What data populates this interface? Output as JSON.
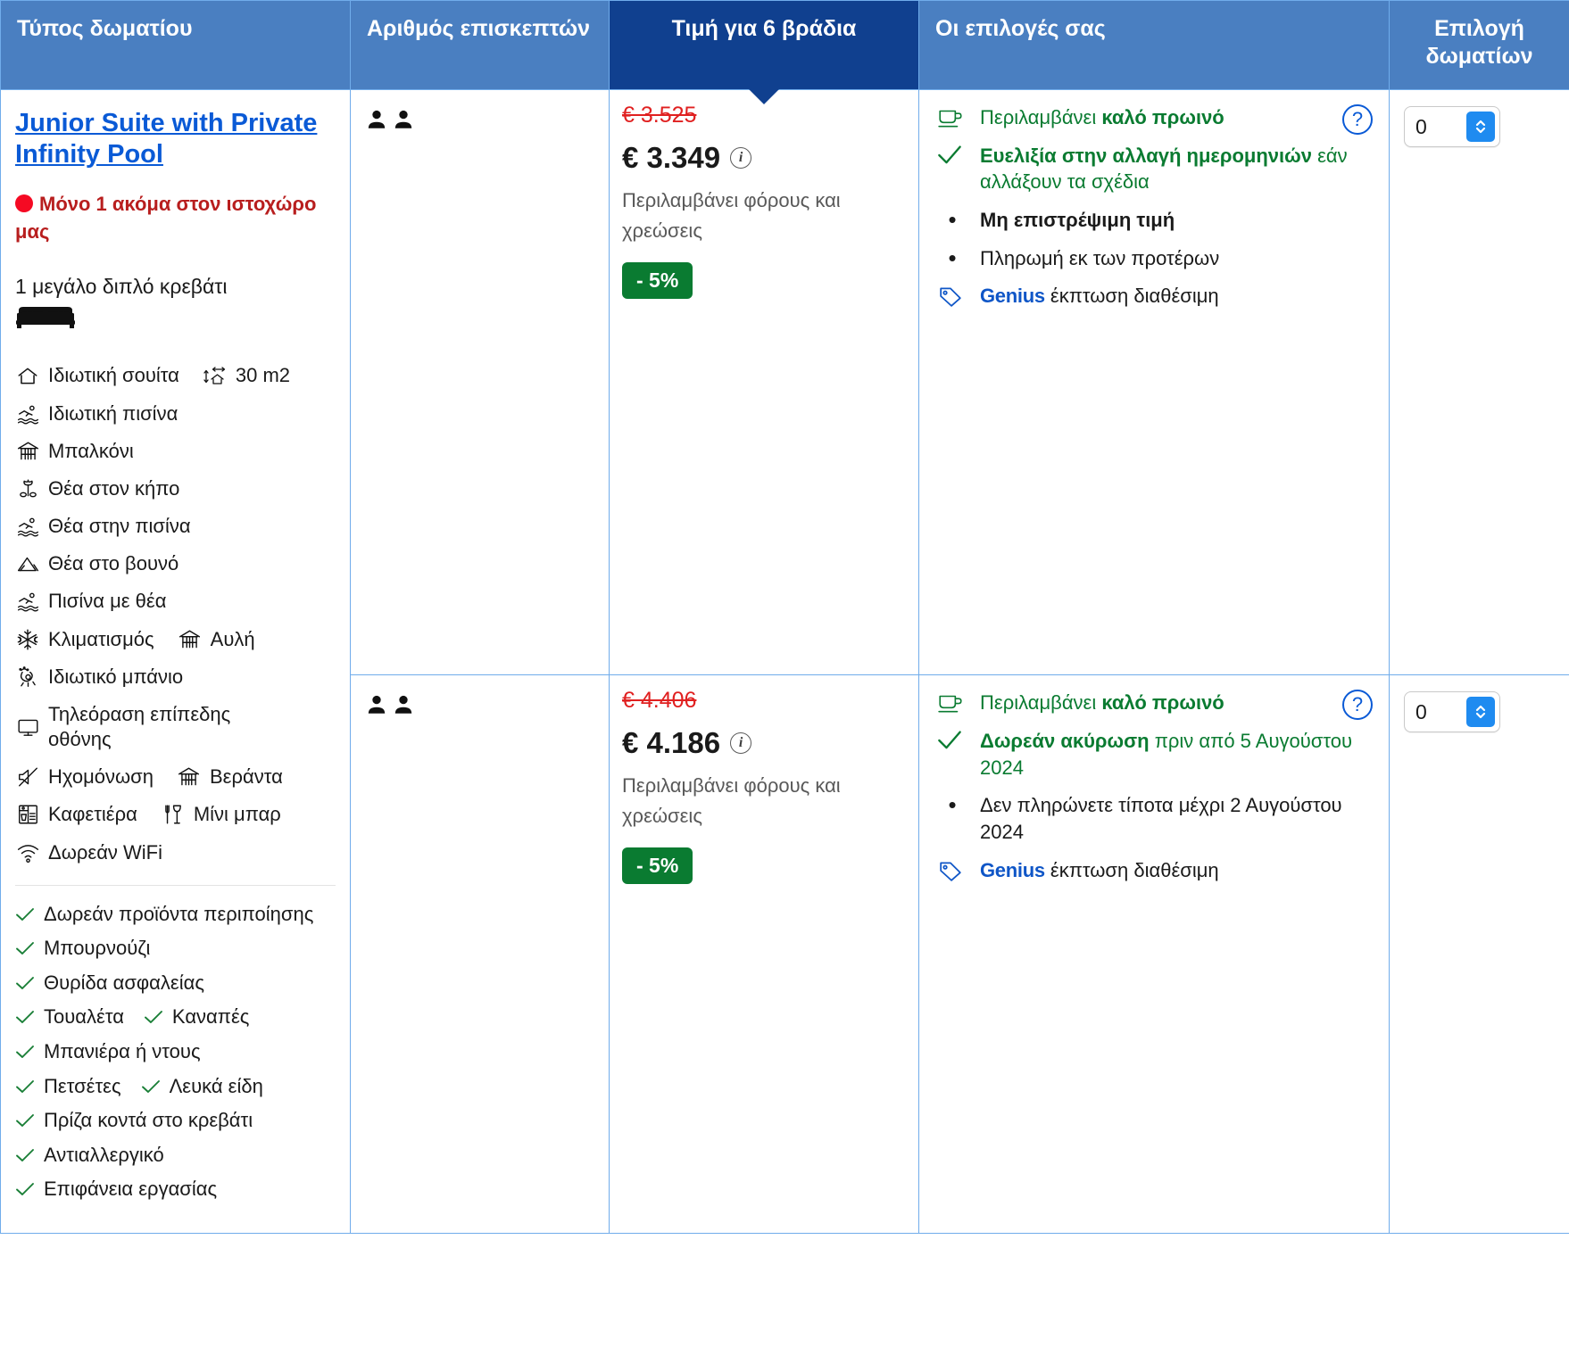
{
  "header": {
    "room_type": "Τύπος δωματίου",
    "guests": "Αριθμός επισκεπτών",
    "price": "Τιμή για 6 βράδια",
    "options": "Οι επιλογές σας",
    "select": "Επιλογή δωματίων"
  },
  "room": {
    "title": "Junior Suite with Private Infinity Pool",
    "scarcity": "Μόνο 1 ακόμα στον ιστοχώρο μας",
    "bed": "1 μεγάλο διπλό κρεβάτι",
    "facilities": [
      [
        {
          "icon": "house-icon",
          "label": "Ιδιωτική σουίτα"
        },
        {
          "icon": "area-size-icon",
          "label": "30 m2"
        }
      ],
      [
        {
          "icon": "swimming-pool-icon",
          "label": "Ιδιωτική πισίνα"
        }
      ],
      [
        {
          "icon": "balcony-icon",
          "label": "Μπαλκόνι"
        }
      ],
      [
        {
          "icon": "garden-view-icon",
          "label": "Θέα στον κήπο"
        }
      ],
      [
        {
          "icon": "swimming-pool-icon",
          "label": "Θέα στην πισίνα"
        }
      ],
      [
        {
          "icon": "mountain-view-icon",
          "label": "Θέα στο βουνό"
        }
      ],
      [
        {
          "icon": "swimming-pool-icon",
          "label": "Πισίνα με θέα"
        }
      ],
      [
        {
          "icon": "snowflake-icon",
          "label": "Κλιματισμός"
        },
        {
          "icon": "balcony-icon",
          "label": "Αυλή"
        }
      ],
      [
        {
          "icon": "private-bathroom-icon",
          "label": "Ιδιωτικό μπάνιο"
        }
      ],
      [
        {
          "icon": "tv-icon",
          "label": "Τηλεόραση επίπεδης οθόνης",
          "wrap": true
        }
      ],
      [
        {
          "icon": "soundproof-icon",
          "label": "Ηχομόνωση"
        },
        {
          "icon": "balcony-icon",
          "label": "Βεράντα"
        }
      ],
      [
        {
          "icon": "coffee-machine-icon",
          "label": "Καφετιέρα"
        },
        {
          "icon": "minibar-icon",
          "label": "Μίνι μπαρ"
        }
      ],
      [
        {
          "icon": "wifi-icon",
          "label": "Δωρεάν WiFi"
        }
      ]
    ],
    "checks": [
      [
        {
          "label": "Δωρεάν προϊόντα περιποίησης",
          "wrap": true
        }
      ],
      [
        {
          "label": "Μπουρνούζι"
        }
      ],
      [
        {
          "label": "Θυρίδα ασφαλείας"
        }
      ],
      [
        {
          "label": "Τουαλέτα"
        },
        {
          "label": "Καναπές"
        }
      ],
      [
        {
          "label": "Μπανιέρα ή ντους"
        }
      ],
      [
        {
          "label": "Πετσέτες"
        },
        {
          "label": "Λευκά είδη"
        }
      ],
      [
        {
          "label": "Πρίζα κοντά στο κρεβάτι"
        }
      ],
      [
        {
          "label": "Αντιαλλεργικό"
        }
      ],
      [
        {
          "label": "Επιφάνεια εργασίας"
        }
      ]
    ]
  },
  "rows": [
    {
      "guests_count": 2,
      "price": {
        "old": "€ 3.525",
        "current": "€ 3.349",
        "tax_note": "Περιλαμβάνει φόρους και χρεώσεις",
        "discount_badge": "- 5%"
      },
      "options": [
        {
          "kind": "icon",
          "icon": "breakfast-cup-icon",
          "color": "green",
          "parts": [
            {
              "t": "Περιλαμβάνει ",
              "b": false
            },
            {
              "t": "καλό πρωινό",
              "b": true
            }
          ]
        },
        {
          "kind": "icon",
          "icon": "check-icon",
          "color": "green",
          "parts": [
            {
              "t": "Ευελιξία στην αλλαγή ημερομηνιών",
              "b": true
            },
            {
              "t": " εάν αλλάξουν τα σχέδια",
              "b": false
            }
          ]
        },
        {
          "kind": "bullet",
          "color": "dark",
          "parts": [
            {
              "t": "Μη επιστρέψιμη τιμή",
              "b": true
            }
          ]
        },
        {
          "kind": "bullet",
          "color": "dark",
          "parts": [
            {
              "t": "Πληρωμή εκ των προτέρων",
              "b": false
            }
          ]
        },
        {
          "kind": "genius",
          "icon": "tag-icon",
          "genius_label": "Genius",
          "genius_rest": " έκπτωση διαθέσιμη"
        }
      ],
      "help_icon": "question-mark-icon",
      "select_value": "0"
    },
    {
      "guests_count": 2,
      "price": {
        "old": "€ 4.406",
        "current": "€ 4.186",
        "tax_note": "Περιλαμβάνει φόρους και χρεώσεις",
        "discount_badge": "- 5%"
      },
      "options": [
        {
          "kind": "icon",
          "icon": "breakfast-cup-icon",
          "color": "green",
          "parts": [
            {
              "t": "Περιλαμβάνει ",
              "b": false
            },
            {
              "t": "καλό πρωινό",
              "b": true
            }
          ]
        },
        {
          "kind": "icon",
          "icon": "check-icon",
          "color": "green",
          "parts": [
            {
              "t": "Δωρεάν ακύρωση",
              "b": true
            },
            {
              "t": " πριν από 5 Αυγούστου 2024",
              "b": false
            }
          ]
        },
        {
          "kind": "bullet",
          "color": "dark",
          "parts": [
            {
              "t": "Δεν πληρώνετε τίποτα μέχρι 2 Αυγούστου 2024",
              "b": false
            }
          ]
        },
        {
          "kind": "genius",
          "icon": "tag-icon",
          "genius_label": "Genius",
          "genius_rest": " έκπτωση διαθέσιμη"
        }
      ],
      "help_icon": "question-mark-icon",
      "select_value": "0"
    }
  ],
  "colors": {
    "header_blue": "#4a7fc1",
    "header_dark_blue": "#10408f",
    "border_blue": "#70aceb",
    "link_blue": "#0a5ad6",
    "scarcity_red": "#b81e1e",
    "old_price_red": "#e02020",
    "green": "#0a7b31",
    "genius_blue": "#0f56c7",
    "stepper_blue": "#1f8bf0"
  }
}
